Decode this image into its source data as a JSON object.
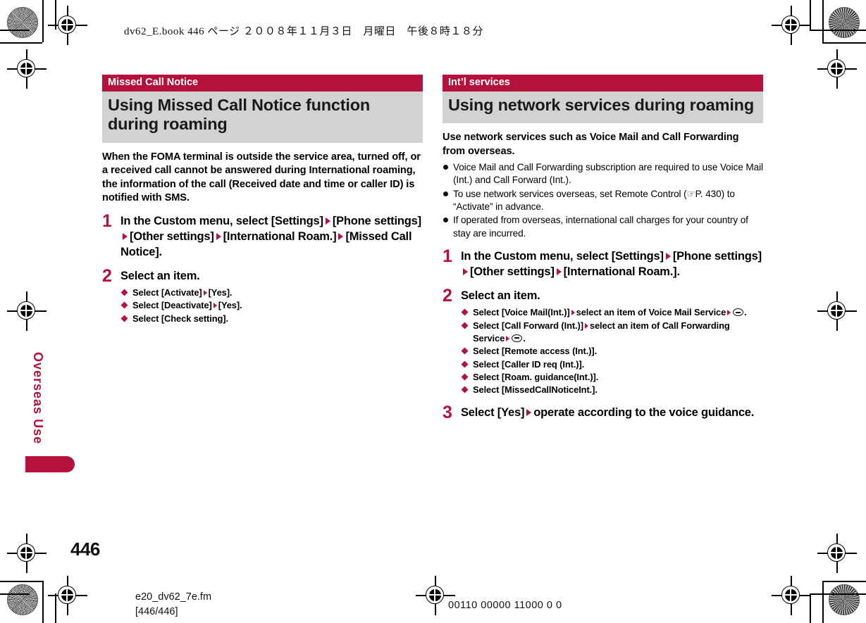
{
  "print_marks": {
    "header_slug": "dv62_E.book  446 ページ  ２００８年１１月３日　月曜日　午後８時１８分",
    "file_name": "e20_dv62_7e.fm",
    "page_range": "[446/446]",
    "binary_code": "00110 00000 11000 0  0",
    "page_number": "446"
  },
  "side_tab": {
    "label": "Overseas Use",
    "color": "#B4123C"
  },
  "colors": {
    "accent": "#B4123C",
    "title_background": "#D2D2D2"
  },
  "left_column": {
    "kicker": "Missed Call Notice",
    "title": "Using Missed Call Notice function during roaming",
    "lead": "When the FOMA terminal is outside the service area, turned off, or a received call cannot be answered during International roaming, the information of the call (Received date and time or caller ID) is notified with SMS.",
    "steps": [
      {
        "number": "1",
        "parts": [
          "In the Custom menu, select [Settings]",
          "[Phone settings]",
          "[Other settings]",
          "[International Roam.]",
          "[Missed Call Notice]."
        ]
      },
      {
        "number": "2",
        "text": "Select an item.",
        "sub_items": [
          {
            "parts": [
              "Select [Activate]",
              "[Yes]."
            ]
          },
          {
            "parts": [
              "Select [Deactivate]",
              "[Yes]."
            ]
          },
          {
            "parts": [
              "Select [Check setting]."
            ]
          }
        ]
      }
    ]
  },
  "right_column": {
    "kicker": "Int’l services",
    "title": "Using network services during roaming",
    "lead": "Use network services such as Voice Mail and Call Forwarding from overseas.",
    "notes": [
      "Voice Mail and Call Forwarding subscription are required to use Voice Mail (Int.) and Call Forward (Int.).",
      "To use network services overseas, set Remote Control (☞P. 430) to “Activate” in advance.",
      "If operated from overseas, international call charges for your country of stay are incurred."
    ],
    "note_reference": {
      "icon": "pointing-hand-icon",
      "page": "P. 430"
    },
    "steps": [
      {
        "number": "1",
        "parts": [
          "In the Custom menu, select [Settings]",
          "[Phone settings]",
          "[Other settings]",
          "[International Roam.]."
        ]
      },
      {
        "number": "2",
        "text": "Select an item.",
        "sub_items": [
          {
            "parts": [
              "Select [Voice Mail(Int.)]",
              "select an item of Voice Mail Service",
              "key-glyph",
              "."
            ]
          },
          {
            "parts": [
              "Select [Call Forward (Int.)]",
              "select an item of Call Forwarding Service",
              "key-glyph",
              "."
            ]
          },
          {
            "parts": [
              "Select [Remote access (Int.)]."
            ]
          },
          {
            "parts": [
              "Select [Caller ID req (Int.)]."
            ]
          },
          {
            "parts": [
              "Select [Roam. guidance(Int.)]."
            ]
          },
          {
            "parts": [
              "Select [MissedCallNoticeInt.]."
            ]
          }
        ]
      },
      {
        "number": "3",
        "parts": [
          "Select [Yes]",
          "operate according to the voice guidance."
        ]
      }
    ]
  }
}
